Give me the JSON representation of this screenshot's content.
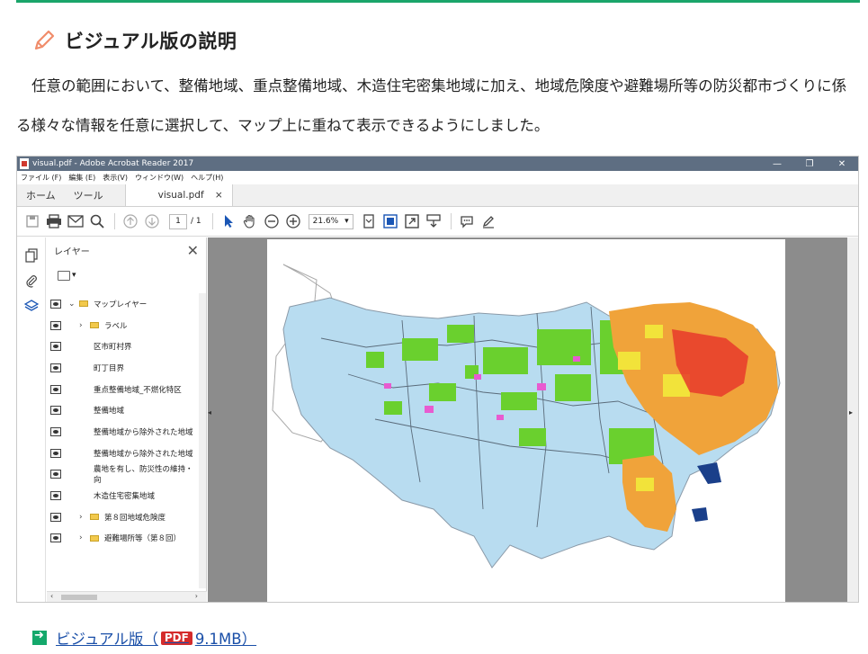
{
  "heading": {
    "title": "ビジュアル版の説明"
  },
  "description": "任意の範囲において、整備地域、重点整備地域、木造住宅密集地域に加え、地域危険度や避難場所等の防災都市づくりに係る様々な情報を任意に選択して、マップ上に重ねて表示できるようにしました。",
  "acrobat": {
    "title": "visual.pdf - Adobe Acrobat Reader 2017",
    "window_buttons": [
      "—",
      "❐",
      "✕"
    ],
    "menu": [
      "ファイル (F)",
      "編集 (E)",
      "表示(V)",
      "ウィンドウ(W)",
      "ヘルプ(H)"
    ],
    "tabs": {
      "home": "ホーム",
      "tools": "ツール",
      "document": "visual.pdf",
      "close": "×"
    },
    "toolbar": {
      "page_current": "1",
      "page_total": "/ 1",
      "zoom": "21.6%"
    },
    "layers_panel": {
      "title": "レイヤー",
      "close": "✕",
      "items": [
        {
          "label": "マップレイヤー",
          "type": "folder",
          "expand": "v"
        },
        {
          "label": "ラベル",
          "type": "folder",
          "expand": ">"
        },
        {
          "label": "区市町村界",
          "type": "layer"
        },
        {
          "label": "町丁目界",
          "type": "layer"
        },
        {
          "label": "重点整備地域_不燃化特区",
          "type": "layer"
        },
        {
          "label": "整備地域",
          "type": "layer"
        },
        {
          "label": "整備地域から除外された地域",
          "type": "layer"
        },
        {
          "label": "整備地域から除外された地域",
          "type": "layer"
        },
        {
          "label": "農地を有し、防災性の維持・向",
          "type": "layer"
        },
        {
          "label": "木造住宅密集地域",
          "type": "layer"
        },
        {
          "label": "第８回地域危険度",
          "type": "folder",
          "expand": ">"
        },
        {
          "label": "避難場所等（第８回）",
          "type": "folder",
          "expand": ">"
        }
      ]
    }
  },
  "download": {
    "label_pre": "ビジュアル版（",
    "badge": "PDF",
    "label_post": "9.1MB）"
  },
  "colors": {
    "accent_green": "#1aa56a",
    "pdf_red": "#d42b2b",
    "link_blue": "#1a4fa8"
  }
}
